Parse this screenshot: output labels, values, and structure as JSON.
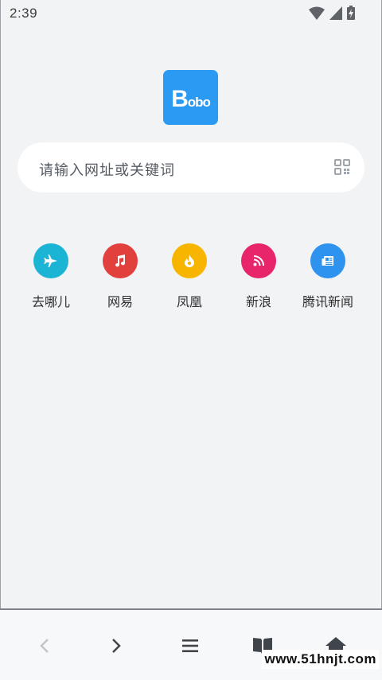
{
  "status_bar": {
    "time": "2:39"
  },
  "logo": {
    "text_cap": "B",
    "text_rest": "obo"
  },
  "search": {
    "placeholder": "请输入网址或关键词"
  },
  "shortcuts": [
    {
      "label": "去哪儿",
      "icon": "plane-icon",
      "color": "#1cb4d4"
    },
    {
      "label": "网易",
      "icon": "music-note-icon",
      "color": "#e2403c"
    },
    {
      "label": "凤凰",
      "icon": "flame-icon",
      "color": "#f8b500"
    },
    {
      "label": "新浪",
      "icon": "rss-icon",
      "color": "#e8246a"
    },
    {
      "label": "腾讯新闻",
      "icon": "newspaper-icon",
      "color": "#2e93ef"
    }
  ],
  "bottom_nav": {
    "items": [
      "back-icon",
      "forward-icon",
      "menu-icon",
      "bookmarks-icon",
      "home-icon"
    ]
  },
  "watermark": {
    "text": "www.51hnjt.com"
  }
}
